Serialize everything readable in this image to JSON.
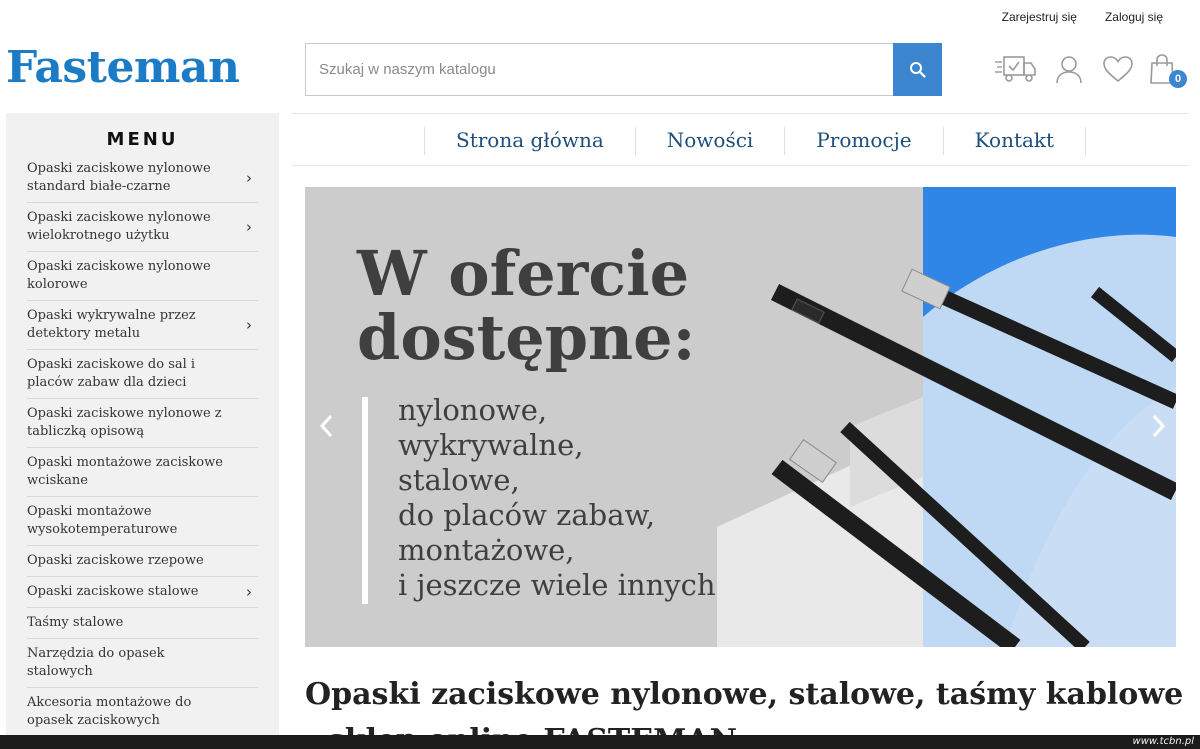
{
  "header": {
    "register_label": "Zarejestruj się",
    "login_label": "Zaloguj się",
    "logo_text": "Fasteman",
    "search_placeholder": "Szukaj w naszym katalogu",
    "cart_count": "0"
  },
  "sidebar": {
    "title": "MENU",
    "items": [
      {
        "label": "Opaski zaciskowe nylonowe standard białe-czarne",
        "has_submenu": true
      },
      {
        "label": "Opaski zaciskowe nylonowe wielokrotnego użytku",
        "has_submenu": true
      },
      {
        "label": "Opaski zaciskowe nylonowe kolorowe",
        "has_submenu": false
      },
      {
        "label": "Opaski wykrywalne przez detektory metalu",
        "has_submenu": true
      },
      {
        "label": "Opaski zaciskowe do sal i placów zabaw dla dzieci",
        "has_submenu": false
      },
      {
        "label": "Opaski zaciskowe nylonowe z tabliczką opisową",
        "has_submenu": false
      },
      {
        "label": "Opaski montażowe zaciskowe wciskane",
        "has_submenu": false
      },
      {
        "label": "Opaski montażowe wysokotemperaturowe",
        "has_submenu": false
      },
      {
        "label": "Opaski zaciskowe rzepowe",
        "has_submenu": false
      },
      {
        "label": "Opaski zaciskowe stalowe",
        "has_submenu": true
      },
      {
        "label": "Taśmy stalowe",
        "has_submenu": false
      },
      {
        "label": "Narzędzia do opasek stalowych",
        "has_submenu": false
      },
      {
        "label": "Akcesoria montażowe do opasek zaciskowych",
        "has_submenu": false
      }
    ]
  },
  "nav": {
    "items": [
      "Strona główna",
      "Nowości",
      "Promocje",
      "Kontakt"
    ]
  },
  "banner": {
    "headline_line1": "W ofercie",
    "headline_line2": "dostępne:",
    "list": [
      "nylonowe,",
      "wykrywalne,",
      "stalowe,",
      "do placów zabaw,",
      "montażowe,",
      "i jeszcze wiele innych"
    ]
  },
  "main": {
    "heading": "Opaski zaciskowe nylonowe, stalowe, taśmy kablowe - sklep online FASTEMAN"
  },
  "watermark": "www.tcbn.pl",
  "colors": {
    "brand_blue": "#1b7cc5",
    "search_button": "#3b86cf",
    "nav_text": "#1e4f7a",
    "banner_blue": "#2f86e6"
  }
}
